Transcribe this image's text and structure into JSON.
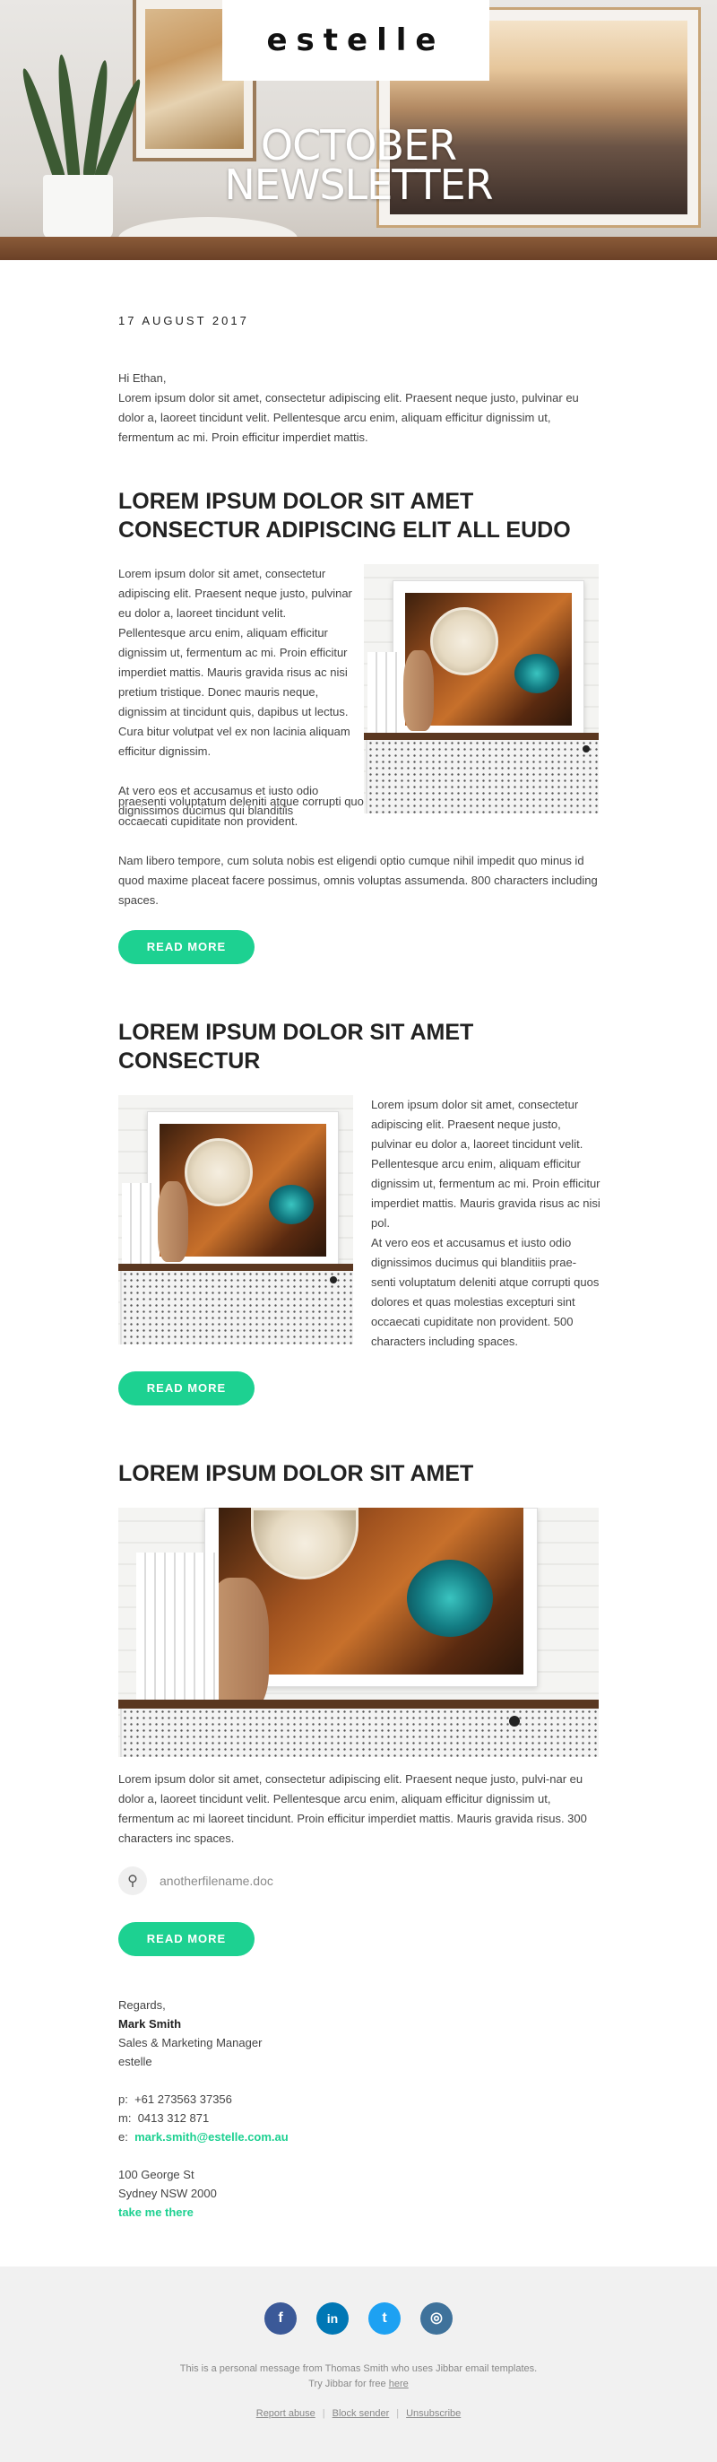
{
  "header": {
    "logo": "estelle",
    "title_line1": "OCTOBER",
    "title_line2": "NEWSLETTER"
  },
  "date": "17 AUGUST 2017",
  "greeting": {
    "salutation": "Hi Ethan,",
    "body": "Lorem ipsum dolor sit amet, consectetur adipiscing elit. Praesent neque justo, pulvinar eu dolor a, laoreet tincidunt velit. Pellentesque arcu enim, aliquam efficitur dignissim ut, fermentum ac mi. Proin efficitur imperdiet mattis."
  },
  "section1": {
    "title": "LOREM IPSUM DOLOR SIT AMET CONSECTUR ADIPISCING ELIT ALL EUDO",
    "wrap_text": "Lorem ipsum dolor sit amet, consectetur adipiscing elit. Praesent neque justo, pulvinar eu dolor a, laoreet tincidunt velit. Pellentesque arcu enim, aliquam efficitur dignissim ut, fermentum ac mi. Proin efficitur imperdiet mattis. Mauris gravida risus ac nisi pretium tristique. Donec mauris neque, dignissim at tincidunt quis, dapibus ut lectus. Cura bitur volutpat vel ex non lacinia aliquam efficitur dignissim.",
    "wrap_text2": "At vero eos et accusamus et iusto odio dignissimos ducimus qui blanditiis",
    "para_cont": "praesenti voluptatum deleniti atque corrupti quos dolores et quas molestias excepturi sint occaecati cupiditate non provident.",
    "para2": "Nam libero tempore, cum soluta nobis est eligendi optio cumque nihil impedit quo minus id quod maxime placeat facere possimus, omnis voluptas assumenda. 800 characters including spaces.",
    "button": "READ MORE"
  },
  "section2": {
    "title": "LOREM IPSUM DOLOR SIT AMET CONSECTUR",
    "text": "Lorem ipsum dolor sit amet, consectetur adipiscing elit. Praesent neque justo, pulvinar eu dolor a, laoreet tincidunt velit. Pellentesque arcu enim, aliquam efficitur dignissim ut, fermentum ac mi. Proin efficitur imperdiet mattis. Mauris gravida risus ac nisi pol.",
    "text2": "At vero eos et accusamus et iusto odio dignissimos ducimus qui blanditiis prae-senti voluptatum deleniti atque corrupti quos dolores et quas molestias excepturi sint occaecati cupiditate non provident. 500 characters including spaces.",
    "button": "READ MORE"
  },
  "section3": {
    "title": "LOREM IPSUM DOLOR SIT AMET",
    "text": "Lorem ipsum dolor sit amet, consectetur adipiscing elit. Praesent neque justo, pulvi-nar eu dolor a, laoreet tincidunt velit. Pellentesque arcu enim, aliquam efficitur dignissim ut, fermentum ac mi laoreet tincidunt. Proin efficitur imperdiet mattis. Mauris gravida risus. 300 characters inc spaces.",
    "attachment": "anotherfilename.doc",
    "button": "READ MORE"
  },
  "signature": {
    "regards": "Regards,",
    "name": "Mark Smith",
    "role": "Sales & Marketing Manager",
    "company": "estelle",
    "phone_label": "p:",
    "phone": "+61 273563 37356",
    "mobile_label": "m:",
    "mobile": "0413 312 871",
    "email_label": "e:",
    "email": "mark.smith@estelle.com.au",
    "address1": "100 George St",
    "address2": "Sydney NSW 2000",
    "map_link": "take me there"
  },
  "footer": {
    "socials": [
      {
        "name": "facebook-icon",
        "glyph": "f",
        "color": "#3b5998"
      },
      {
        "name": "linkedin-icon",
        "glyph": "in",
        "color": "#0077b5"
      },
      {
        "name": "twitter-icon",
        "glyph": "t",
        "color": "#1da1f2"
      },
      {
        "name": "instagram-icon",
        "glyph": "◎",
        "color": "#3f729b"
      }
    ],
    "note1": "This is a personal message from Thomas Smith who uses Jibbar email templates.",
    "note2_prefix": "Try Jibbar for free ",
    "note2_link": "here",
    "link_report": "Report abuse",
    "link_block": "Block sender",
    "link_unsub": "Unsubscribe"
  },
  "colors": {
    "accent": "#1dd191",
    "footer_bg": "#f1f1f1"
  }
}
